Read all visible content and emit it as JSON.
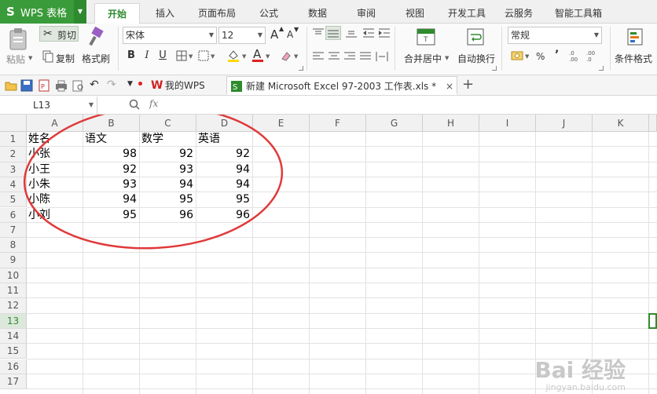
{
  "app": {
    "logo": "S",
    "title": "WPS 表格"
  },
  "menu": {
    "tabs": [
      "开始",
      "插入",
      "页面布局",
      "公式",
      "数据",
      "审阅",
      "视图",
      "开发工具",
      "云服务",
      "智能工具箱"
    ],
    "active_index": 0
  },
  "ribbon": {
    "paste_label": "粘贴",
    "cut_label": "剪切",
    "copy_label": "复制",
    "format_painter_label": "格式刷",
    "font_name": "宋体",
    "font_size": "12",
    "bold": "B",
    "italic": "I",
    "underline": "U",
    "merge_label": "合并居中",
    "wrap_label": "自动换行",
    "number_format": "常规",
    "percent": "%",
    "comma": "’",
    "conditional_label": "条件格式",
    "increase_font": "A",
    "decrease_font": "A",
    "font_color_letter": "A"
  },
  "doc_tabs": {
    "home_label": "我的WPS",
    "file_label": "新建 Microsoft Excel 97-2003 工作表.xls *",
    "new_tab": "+",
    "close": "×"
  },
  "formula_bar": {
    "cell_ref": "L13",
    "fx": "fx"
  },
  "sheet": {
    "columns": [
      "A",
      "B",
      "C",
      "D",
      "E",
      "F",
      "G",
      "H",
      "I",
      "J",
      "K"
    ],
    "rows": [
      "1",
      "2",
      "3",
      "4",
      "5",
      "6",
      "7",
      "8",
      "9",
      "10",
      "11",
      "12",
      "13",
      "14",
      "15",
      "16",
      "17"
    ],
    "selected_row": "13",
    "data": [
      [
        "姓名",
        "语文",
        "数学",
        "英语"
      ],
      [
        "小张",
        "98",
        "92",
        "92"
      ],
      [
        "小王",
        "92",
        "93",
        "94"
      ],
      [
        "小朱",
        "93",
        "94",
        "94"
      ],
      [
        "小陈",
        "94",
        "95",
        "95"
      ],
      [
        "小刘",
        "95",
        "96",
        "96"
      ]
    ]
  },
  "colors": {
    "brand_green": "#3a9b3a",
    "annotation_red": "#e03a3a",
    "selection_green": "#2e8b2e"
  },
  "watermark": {
    "main": "Bai 经验",
    "sub": "jingyan.baidu.com"
  }
}
